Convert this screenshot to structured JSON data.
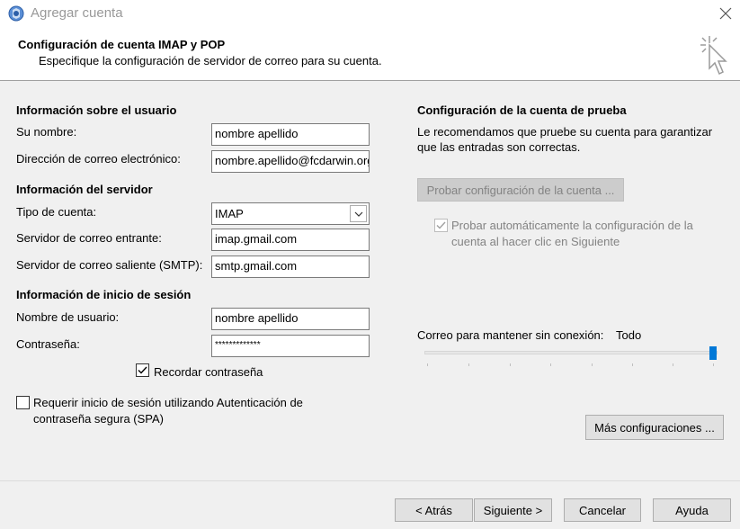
{
  "window": {
    "title": "Agregar cuenta"
  },
  "header": {
    "title": "Configuración de cuenta IMAP y POP",
    "subtitle": "Especifique la configuración de servidor de correo para su cuenta."
  },
  "user_info": {
    "heading": "Información sobre el usuario",
    "name_label": "Su nombre:",
    "name_value": "nombre apellido",
    "email_label": "Dirección de correo electrónico:",
    "email_value": "nombre.apellido@fcdarwin.org"
  },
  "server_info": {
    "heading": "Información del servidor",
    "account_type_label": "Tipo de cuenta:",
    "account_type_value": "IMAP",
    "incoming_label": "Servidor de correo entrante:",
    "incoming_value": "imap.gmail.com",
    "outgoing_label": "Servidor de correo saliente (SMTP):",
    "outgoing_value": "smtp.gmail.com"
  },
  "login_info": {
    "heading": "Información de inicio de sesión",
    "username_label": "Nombre de usuario:",
    "username_value": "nombre apellido",
    "password_label": "Contraseña:",
    "password_value": "*************",
    "remember_label": "Recordar contraseña",
    "remember_checked": true,
    "spa_label_line1": "Requerir inicio de sesión utilizando Autenticación de",
    "spa_label_line2": "contraseña segura (SPA)",
    "spa_checked": false
  },
  "test_settings": {
    "heading": "Configuración de la cuenta de prueba",
    "desc_line1": "Le recomendamos que pruebe su cuenta para garantizar",
    "desc_line2": "que las entradas son correctas.",
    "test_button": "Probar configuración de la cuenta ...",
    "auto_test_line1": "Probar automáticamente la configuración de la",
    "auto_test_line2": "cuenta al hacer clic en Siguiente",
    "auto_test_checked": true
  },
  "offline": {
    "label": "Correo para mantener sin conexión:",
    "value": "Todo",
    "slider_level": 1.0
  },
  "more_settings_button": "Más configuraciones ...",
  "footer": {
    "back": "< Atrás",
    "next": "Siguiente >",
    "cancel": "Cancelar",
    "help": "Ayuda"
  },
  "colors": {
    "accent": "#0078d7"
  }
}
